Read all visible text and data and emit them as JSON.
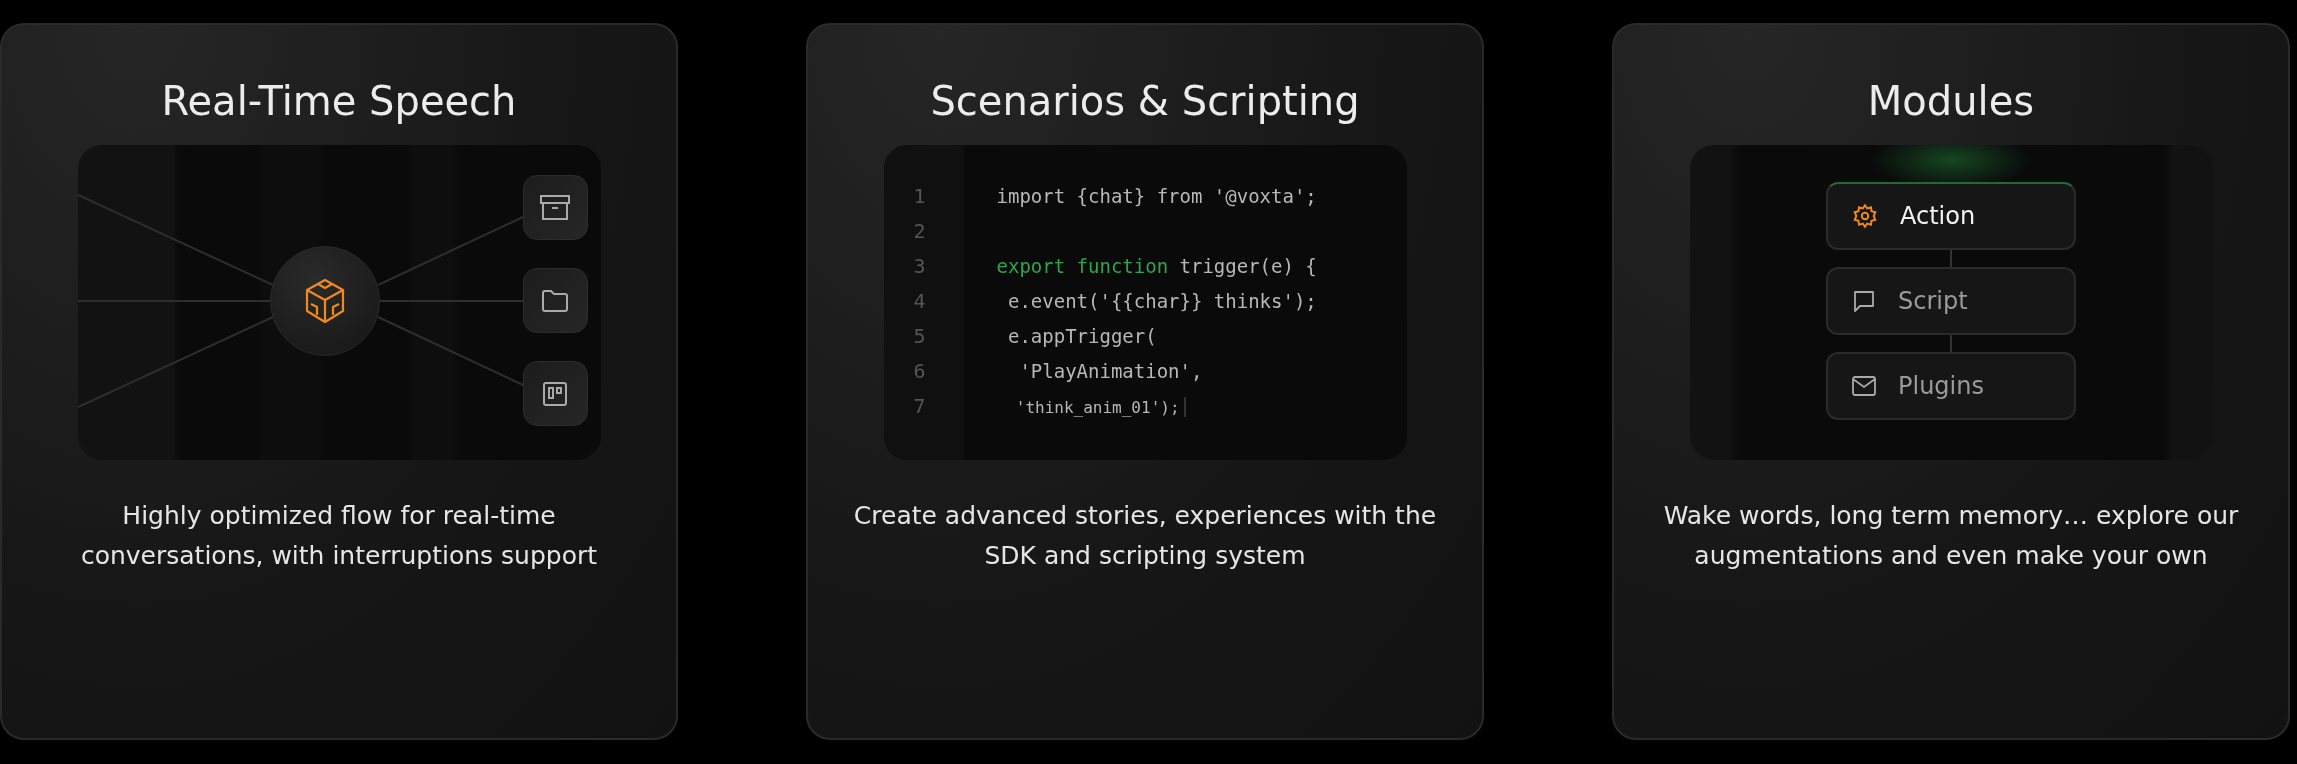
{
  "cards": [
    {
      "title": "Real-Time Speech",
      "description": "Highly optimized flow for real-time conversations, with interruptions support",
      "visual": {
        "kind": "hub",
        "side_buttons": [
          {
            "kind": "archive"
          },
          {
            "kind": "folder"
          },
          {
            "kind": "board"
          }
        ]
      }
    },
    {
      "title": "Scenarios & Scripting",
      "description": "Create advanced stories, experiences with the SDK and scripting system",
      "visual": {
        "kind": "code",
        "lines": [
          {
            "number": "1",
            "tokens": [
              {
                "kind": "plain",
                "text": "import {chat} from '@voxta';"
              }
            ]
          },
          {
            "number": "2"
          },
          {
            "number": "3",
            "tokens": [
              {
                "kind": "keyword",
                "text": "export function"
              },
              {
                "kind": "plain",
                "text": " trigger(e) {"
              }
            ]
          },
          {
            "number": "4",
            "tokens": [
              {
                "kind": "plain",
                "text": " e.event('{{char}} thinks');"
              }
            ]
          },
          {
            "number": "5",
            "tokens": [
              {
                "kind": "plain",
                "text": " e.appTrigger("
              }
            ]
          },
          {
            "number": "6",
            "tokens": [
              {
                "kind": "plain",
                "text": "  'PlayAnimation',"
              }
            ]
          },
          {
            "number": "7",
            "tokens": [
              {
                "kind": "small",
                "text": "  'think_anim_01');"
              }
            ]
          }
        ]
      }
    },
    {
      "title": "Modules",
      "description": "Wake words, long term memory… explore our augmentations and even make your own",
      "visual": {
        "kind": "modules",
        "items": [
          {
            "label": "Action",
            "kind": "gear",
            "selected": true
          },
          {
            "label": "Script",
            "kind": "chat",
            "selected": false
          },
          {
            "label": "Plugins",
            "kind": "mail",
            "selected": false
          }
        ]
      }
    }
  ]
}
